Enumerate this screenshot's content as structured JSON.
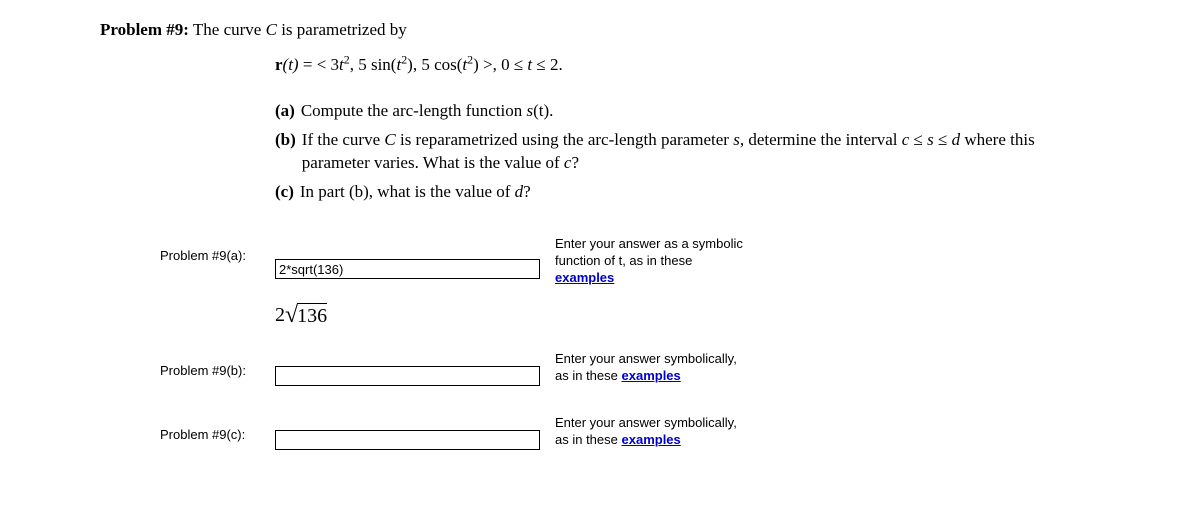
{
  "header": {
    "number": "Problem #9:",
    "intro_a": " The curve ",
    "intro_c": "C",
    "intro_b": " is parametrized by"
  },
  "equation": {
    "r": "r",
    "of_t": "(t)",
    "eq": " = ",
    "lt": "< 3",
    "t1": "t",
    "sq1": "2",
    "comma1": ", 5 sin(",
    "t2": "t",
    "sq2": "2",
    "mid": "), 5 cos(",
    "t3": "t",
    "sq3": "2",
    "close": ") >,   0 ≤ ",
    "t4": "t",
    "end": " ≤ 2."
  },
  "parts": {
    "a_label": "(a)",
    "a_text_1": "Compute the arc-length function ",
    "a_text_s": "s",
    "a_text_2": "(t).",
    "b_label": "(b)",
    "b_text_1": "If the curve ",
    "b_text_c": "C",
    "b_text_2": " is reparametrized using the arc-length parameter ",
    "b_text_s": "s",
    "b_text_3": ", determine the interval ",
    "b_text_ci": "c",
    "b_text_4": " ≤ ",
    "b_text_si": "s",
    "b_text_5": " ≤ ",
    "b_text_d": "d",
    "b_text_6": " where this parameter varies. What is the value of ",
    "b_text_cv": "c",
    "b_text_7": "?",
    "c_label": "(c)",
    "c_text_1": "In part (b), what is the value of ",
    "c_text_d": "d",
    "c_text_2": "?"
  },
  "answers": {
    "a": {
      "label": "Problem #9(a):",
      "value": "2*sqrt(136)",
      "rendered_prefix": "2",
      "rendered_radical": "√",
      "rendered_radicand": "136",
      "hint_line1": "Enter your answer as a symbolic",
      "hint_line2": "function of t, as in these",
      "hint_link": "examples"
    },
    "b": {
      "label": "Problem #9(b):",
      "value": "",
      "hint_line1": "Enter your answer symbolically,",
      "hint_line2": "as in these ",
      "hint_link": "examples"
    },
    "c": {
      "label": "Problem #9(c):",
      "value": "",
      "hint_line1": "Enter your answer symbolically,",
      "hint_line2": "as in these ",
      "hint_link": "examples"
    }
  }
}
